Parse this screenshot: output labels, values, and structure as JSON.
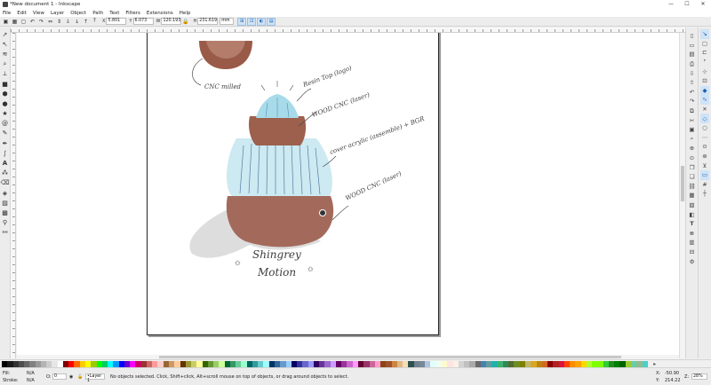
{
  "window": {
    "title": "*New document 1 - Inkscape",
    "minimize": "—",
    "maximize": "☐",
    "close": "✕"
  },
  "menu": [
    "File",
    "Edit",
    "View",
    "Layer",
    "Object",
    "Path",
    "Text",
    "Filters",
    "Extensions",
    "Help"
  ],
  "tool_controls": {
    "x_label": "X",
    "x_value": "5.801",
    "y_label": "Y",
    "y_value": "6.073",
    "w_label": "W",
    "w_value": "120.193",
    "h_label": "H",
    "h_value": "231.619",
    "unit": "mm"
  },
  "sketch_annotations": {
    "cnc_milled": "CNC milled",
    "resin_top": "Resin Top (logo)",
    "wood_cnc_upper": "WOOD CNC (laser)",
    "glass_cover": "cover acrylic (assemble) + BGR",
    "wood_cnc_lower": "WOOD CNC (laser)",
    "signature_line1": "Shingrey",
    "signature_line2": "Motion"
  },
  "colors": {
    "brown_dark": "#7a4030",
    "brown_mid": "#a86a5a",
    "glass_blue": "#a7dbe9",
    "shadow_gray": "#cfcfcf",
    "accent_blue": "#cfe3f7"
  },
  "palette": {
    "swatches": [
      "#000000",
      "#1a1a1a",
      "#333333",
      "#4d4d4d",
      "#666666",
      "#808080",
      "#999999",
      "#b3b3b3",
      "#cccccc",
      "#e6e6e6",
      "#ffffff",
      "#800000",
      "#ff0000",
      "#ff6600",
      "#ffcc00",
      "#ffff00",
      "#99cc00",
      "#00ff00",
      "#00cc66",
      "#00ffff",
      "#0099ff",
      "#0000ff",
      "#6600cc",
      "#ff00ff",
      "#cc0066",
      "#993333",
      "#cc6666",
      "#ff9999",
      "#ffcccc",
      "#996633",
      "#cc9966",
      "#ffcc99",
      "#663300",
      "#999933",
      "#cccc66",
      "#ffff99",
      "#336600",
      "#669933",
      "#99cc66",
      "#ccff99",
      "#006633",
      "#339966",
      "#66cc99",
      "#99ffcc",
      "#006666",
      "#339999",
      "#66cccc",
      "#99ffff",
      "#003366",
      "#336699",
      "#6699cc",
      "#99ccff",
      "#000066",
      "#333399",
      "#6666cc",
      "#9999ff",
      "#330066",
      "#663399",
      "#9966cc",
      "#cc99ff",
      "#660066",
      "#993399",
      "#cc66cc",
      "#ff99ff",
      "#660033",
      "#993366",
      "#cc6699",
      "#ff99cc",
      "#8b4513",
      "#a0522d",
      "#cd853f",
      "#deb887",
      "#f5deb3",
      "#2f4f4f",
      "#708090",
      "#778899",
      "#b0c4de",
      "#e0ffff",
      "#f0fff0",
      "#fffacd",
      "#ffe4e1",
      "#faf0e6",
      "#d3d3d3",
      "#c0c0c0",
      "#a9a9a9",
      "#696969",
      "#4682b4",
      "#5f9ea0",
      "#20b2aa",
      "#3cb371",
      "#2e8b57",
      "#556b2f",
      "#6b8e23",
      "#808000",
      "#bdb76b",
      "#daa520",
      "#b8860b",
      "#d2691e",
      "#8b0000",
      "#b22222",
      "#dc143c",
      "#ff4500",
      "#ff8c00",
      "#ffa500",
      "#ffd700",
      "#adff2f",
      "#7fff00",
      "#7cfc00",
      "#32cd32",
      "#228b22",
      "#008000",
      "#006400",
      "#9acd32",
      "#66cdaa",
      "#8fbc8f",
      "#48d1cc"
    ],
    "menu_icon": "▸"
  },
  "status": {
    "fill_label": "Fill:",
    "fill_value": "N/A",
    "stroke_label": "Stroke:",
    "stroke_value": "N/A",
    "opacity_label": "O:",
    "opacity_value": "0",
    "layer_value": "•Layer 1",
    "message": "No objects selected. Click, Shift+click, Alt+scroll mouse on top of objects, or drag around objects to select.",
    "x_label": "X:",
    "x_value": "-50.90",
    "y_label": "Y:",
    "y_value": "214.22",
    "z_label": "Z:",
    "zoom_value": "28%"
  }
}
